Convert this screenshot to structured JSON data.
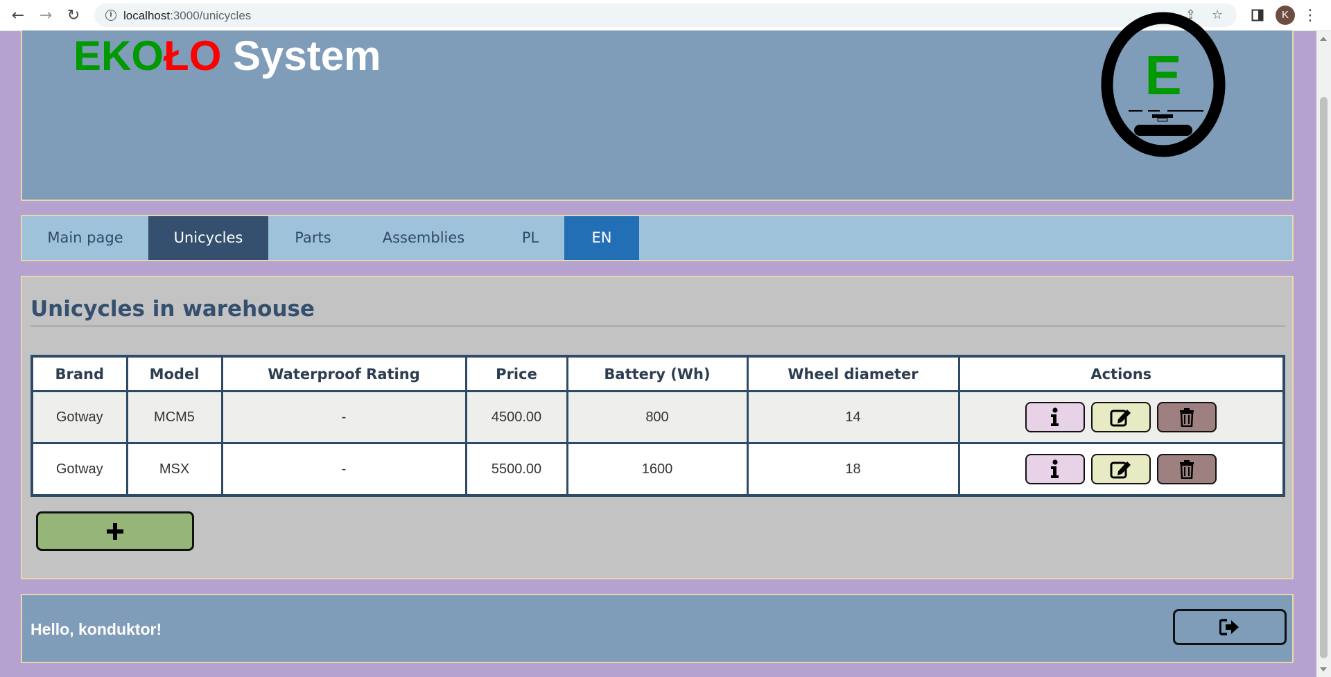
{
  "browser": {
    "url_host": "localhost",
    "url_path": ":3000/unicycles",
    "profile_initial": "K"
  },
  "header": {
    "brand_green_1": "EK",
    "brand_green_2": "O",
    "brand_red_1": "Ł",
    "brand_red_2": "O",
    "brand_white": "System",
    "logo_letter": "E"
  },
  "nav": {
    "tabs": [
      {
        "label": "Main page"
      },
      {
        "label": "Unicycles",
        "active": true
      },
      {
        "label": "Parts"
      },
      {
        "label": "Assemblies"
      },
      {
        "label": "PL"
      },
      {
        "label": "EN",
        "active": true
      }
    ]
  },
  "main": {
    "title": "Unicycles in warehouse",
    "table": {
      "columns": [
        "Brand",
        "Model",
        "Waterproof Rating",
        "Price",
        "Battery (Wh)",
        "Wheel diameter",
        "Actions"
      ],
      "rows": [
        {
          "brand": "Gotway",
          "model": "MCM5",
          "waterproof": "-",
          "price": "4500.00",
          "battery": "800",
          "wheel": "14"
        },
        {
          "brand": "Gotway",
          "model": "MSX",
          "waterproof": "-",
          "price": "5500.00",
          "battery": "1600",
          "wheel": "18"
        }
      ]
    },
    "add_button_icon": "plus-icon"
  },
  "footer": {
    "greeting": "Hello, konduktor!",
    "logout_icon": "sign-out-icon"
  },
  "colors": {
    "page_bg": "#b5a2d0",
    "header_bg": "#7f9cb9",
    "nav_bg": "#9fc2db",
    "nav_active": "#34506e",
    "lang_active": "#226fb5",
    "content_bg": "#c3c3c3",
    "info_btn": "#e8d2e8",
    "edit_btn": "#e8eac3",
    "delete_btn": "#9e8080",
    "add_btn": "#95b678",
    "brand_green": "#009a00",
    "brand_red": "#ff0000"
  }
}
